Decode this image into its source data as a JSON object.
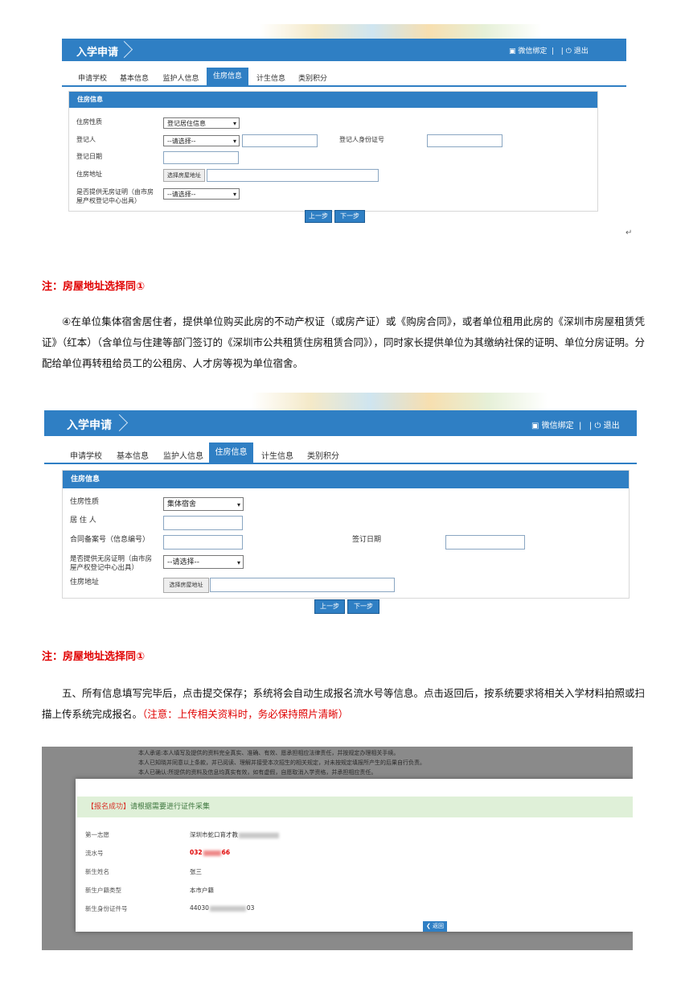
{
  "screenshot1": {
    "app_title": "入学申请",
    "wechat_bind": "微信绑定",
    "separator": "|",
    "logout": "退出",
    "tabs": [
      "申请学校",
      "基本信息",
      "监护人信息",
      "住房信息",
      "计生信息",
      "类别积分"
    ],
    "active_tab": "住房信息",
    "panel_title": "住房信息",
    "fields": {
      "housing_nature_label": "住房性质",
      "housing_nature_value": "登记居住信息",
      "registrant_label": "登记人",
      "registrant_select": "--请选择--",
      "registrant_id_label": "登记人身份证号",
      "register_date_label": "登记日期",
      "address_label": "住房地址",
      "address_button": "选择房屋地址",
      "proof_label": "是否提供无房证明（由市房屋产权登记中心出具）",
      "proof_select": "--请选择--"
    },
    "prev_button": "上一步",
    "next_button": "下一步"
  },
  "note1": "注：房屋地址选择同①",
  "paragraph1": "④在单位集体宿舍居住者，提供单位购买此房的不动产权证（或房产证）或《购房合同》，或者单位租用此房的《深圳市房屋租赁凭证》（红本）（含单位与住建等部门签订的《深圳市公共租赁住房租赁合同》），同时家长提供单位为其缴纳社保的证明、单位分房证明。分配给单位再转租给员工的公租房、人才房等视为单位宿舍。",
  "screenshot2": {
    "app_title": "入学申请",
    "wechat_bind": "微信绑定",
    "separator": "|",
    "logout": "退出",
    "tabs": [
      "申请学校",
      "基本信息",
      "监护人信息",
      "住房信息",
      "计生信息",
      "类别积分"
    ],
    "active_tab": "住房信息",
    "panel_title": "住房信息",
    "fields": {
      "housing_nature_label": "住房性质",
      "housing_nature_value": "集体宿舍",
      "resident_label": "居 住 人",
      "contract_label": "合同备案号（信息编号）",
      "sign_date_label": "签订日期",
      "proof_label": "是否提供无房证明（由市房屋产权登记中心出具）",
      "proof_select": "--请选择--",
      "address_label": "住房地址",
      "address_button": "选择房屋地址"
    },
    "prev_button": "上一步",
    "next_button": "下一步"
  },
  "note2": "注：房屋地址选择同①",
  "paragraph2_main": "五、所有信息填写完毕后，点击提交保存；系统将会自动生成报名流水号等信息。点击返回后，按系统要求将相关入学材料拍照或扫描上传系统完成报名。",
  "paragraph2_red": "（注意：上传相关资料时，务必保持照片清晰）",
  "screenshot3": {
    "ghost_lines": [
      "本人承诺:本人填写及提供的资料完全真实、准确、有效、愿承担相应法律责任，并按规定办理相关手续。",
      "本人已知晓并同意以上条款，并已阅读、理解并接受本次招生的相关规定，对未按规定填报所产生的后果自行负责。",
      "本人已确认:所提供的资料及信息均真实有效，如有虚假，自愿取消入学资格，并承担相应责任。"
    ],
    "success_prefix": "【报名成功】",
    "success_text": "请根据需要进行证件采集",
    "rows": [
      {
        "k": "第一志愿",
        "v": "深圳市蛇口育才教"
      },
      {
        "k": "流水号",
        "v": "032",
        "v2": "66"
      },
      {
        "k": "新生姓名",
        "v": "张三"
      },
      {
        "k": "新生户籍类型",
        "v": "本市户籍"
      },
      {
        "k": "新生身份证件号",
        "v": "44030",
        "v2": "03"
      }
    ],
    "back_button": "返回"
  }
}
